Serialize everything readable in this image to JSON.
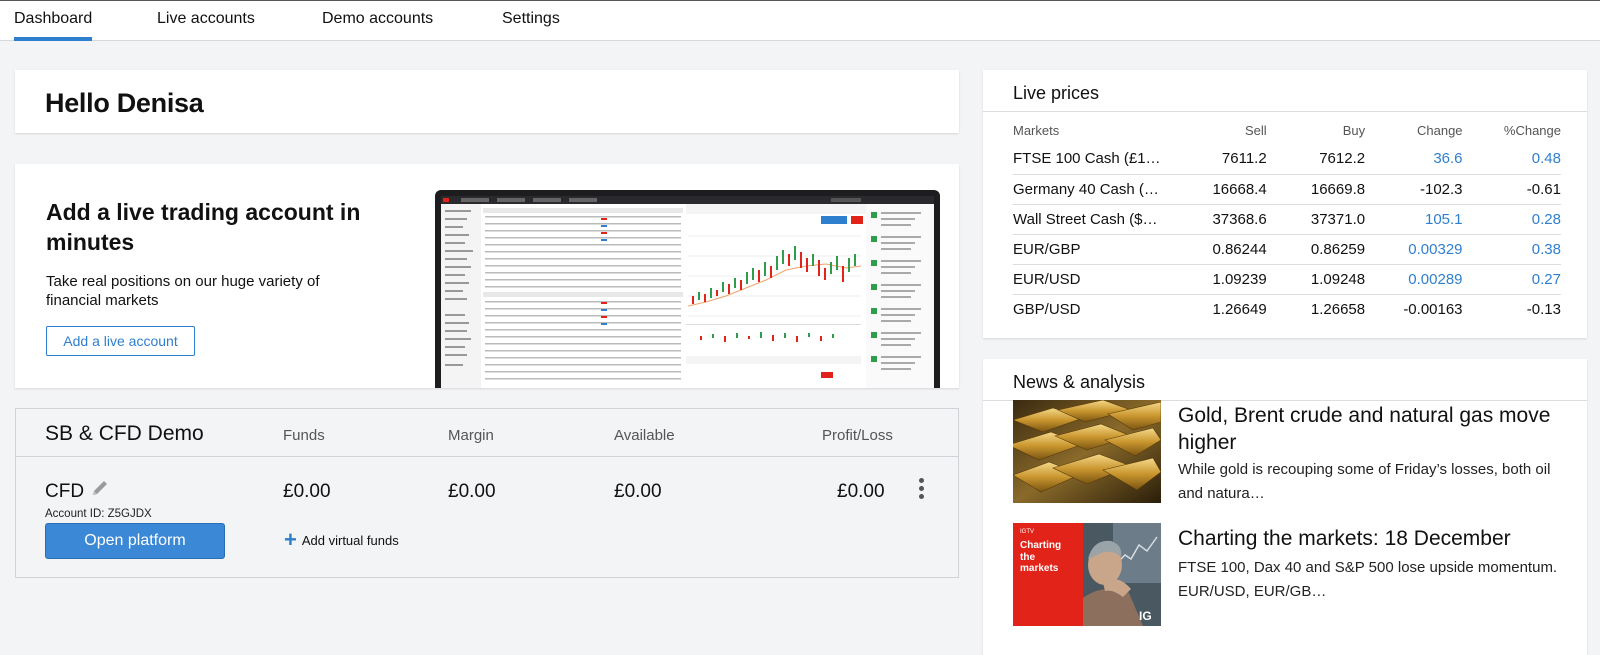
{
  "nav": {
    "tabs": [
      {
        "label": "Dashboard",
        "active": true
      },
      {
        "label": "Live accounts",
        "active": false
      },
      {
        "label": "Demo accounts",
        "active": false
      },
      {
        "label": "Settings",
        "active": false
      }
    ]
  },
  "greeting": {
    "text": "Hello Denisa"
  },
  "promo": {
    "title": "Add a live trading account in minutes",
    "body": "Take real positions on our huge variety of financial markets",
    "button_label": "Add a live account"
  },
  "demo_account": {
    "title": "SB & CFD Demo",
    "columns": [
      "Funds",
      "Margin",
      "Available",
      "Profit/Loss"
    ],
    "account_name": "CFD",
    "account_id": "Account ID: Z5GJDX",
    "funds": "£0.00",
    "margin": "£0.00",
    "available": "£0.00",
    "profit_loss": "£0.00",
    "open_button": "Open platform",
    "add_funds": "Add virtual funds"
  },
  "live_prices": {
    "title": "Live prices",
    "headers": [
      "Markets",
      "Sell",
      "Buy",
      "Change",
      "%Change"
    ],
    "rows": [
      {
        "market": "FTSE 100 Cash (£1…",
        "sell": "7611.2",
        "buy": "7612.2",
        "change": "36.6",
        "pct": "0.48",
        "up": true
      },
      {
        "market": "Germany 40 Cash (…",
        "sell": "16668.4",
        "buy": "16669.8",
        "change": "-102.3",
        "pct": "-0.61",
        "up": false
      },
      {
        "market": "Wall Street Cash ($…",
        "sell": "37368.6",
        "buy": "37371.0",
        "change": "105.1",
        "pct": "0.28",
        "up": true
      },
      {
        "market": "EUR/GBP",
        "sell": "0.86244",
        "buy": "0.86259",
        "change": "0.00329",
        "pct": "0.38",
        "up": true
      },
      {
        "market": "EUR/USD",
        "sell": "1.09239",
        "buy": "1.09248",
        "change": "0.00289",
        "pct": "0.27",
        "up": true
      },
      {
        "market": "GBP/USD",
        "sell": "1.26649",
        "buy": "1.26658",
        "change": "-0.00163",
        "pct": "-0.13",
        "up": false
      }
    ],
    "colors": {
      "positive": "#2f7fcf",
      "neutral": "#111111"
    }
  },
  "news": {
    "title": "News & analysis",
    "items": [
      {
        "headline": "Gold, Brent crude and natural gas move higher",
        "summary": "While gold is recouping some of Friday’s losses, both oil and natura…",
        "thumb_icon": "gold-bars-image"
      },
      {
        "headline": "Charting the markets: 18 December",
        "summary": "FTSE 100, Dax 40 and S&P 500 lose upside momentum. EUR/USD, EUR/GB…",
        "thumb_icon": "charting-markets-image",
        "thumb_text": "Charting the markets",
        "thumb_tag": "IGTV",
        "thumb_logo": "IG"
      }
    ]
  },
  "brand": {
    "accent": "#2f7fcf",
    "button": "#3a88d6",
    "thumb_red": "#e2231a"
  }
}
